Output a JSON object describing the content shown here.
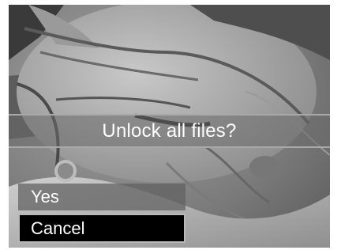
{
  "dialog": {
    "prompt": "Unlock all files?"
  },
  "menu": {
    "options": [
      {
        "label": "Yes",
        "selected": false
      },
      {
        "label": "Cancel",
        "selected": true
      }
    ]
  },
  "colors": {
    "overlay": "#696969",
    "selected_background": "#000000",
    "text": "#ffffff"
  }
}
